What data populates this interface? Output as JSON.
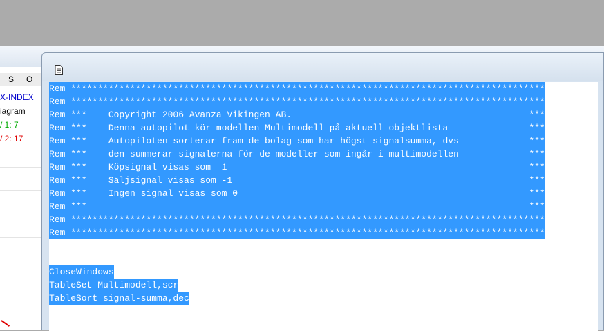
{
  "background_panel": {
    "column_headers": [
      "S",
      "O"
    ],
    "lines": [
      {
        "text": "X-INDEX",
        "color": "#0000cc"
      },
      {
        "text": "iagram",
        "color": "#000000"
      },
      {
        "text": "/ 1: 7",
        "color": "#00aa00"
      },
      {
        "text": "/ 2: 17",
        "color": "#e00000"
      }
    ]
  },
  "editor": {
    "doc_icon": "document-icon",
    "selection_color": "#3399ff",
    "lines": [
      "Rem ****************************************************************************************",
      "Rem ****************************************************************************************",
      "Rem ***    Copyright 2006 Avanza Vikingen AB.                                            ***",
      "Rem ***    Denna autopilot kör modellen Multimodell på aktuell objektlista               ***",
      "Rem ***    Autopiloten sorterar fram de bolag som har högst signalsumma, dvs             ***",
      "Rem ***    den summerar signalerna för de modeller som ingår i multimodellen             ***",
      "Rem ***    Köpsignal visas som  1                                                        ***",
      "Rem ***    Säljsignal visas som -1                                                       ***",
      "Rem ***    Ingen signal visas som 0                                                      ***",
      "Rem ***                                                                                  ***",
      "Rem ****************************************************************************************",
      "Rem ****************************************************************************************",
      "",
      "",
      "CloseWindows",
      "TableSet Multimodell,scr",
      "TableSort signal-summa,dec"
    ],
    "selected_lines": [
      0,
      1,
      2,
      3,
      4,
      5,
      6,
      7,
      8,
      9,
      10,
      11,
      14,
      15,
      16
    ]
  }
}
